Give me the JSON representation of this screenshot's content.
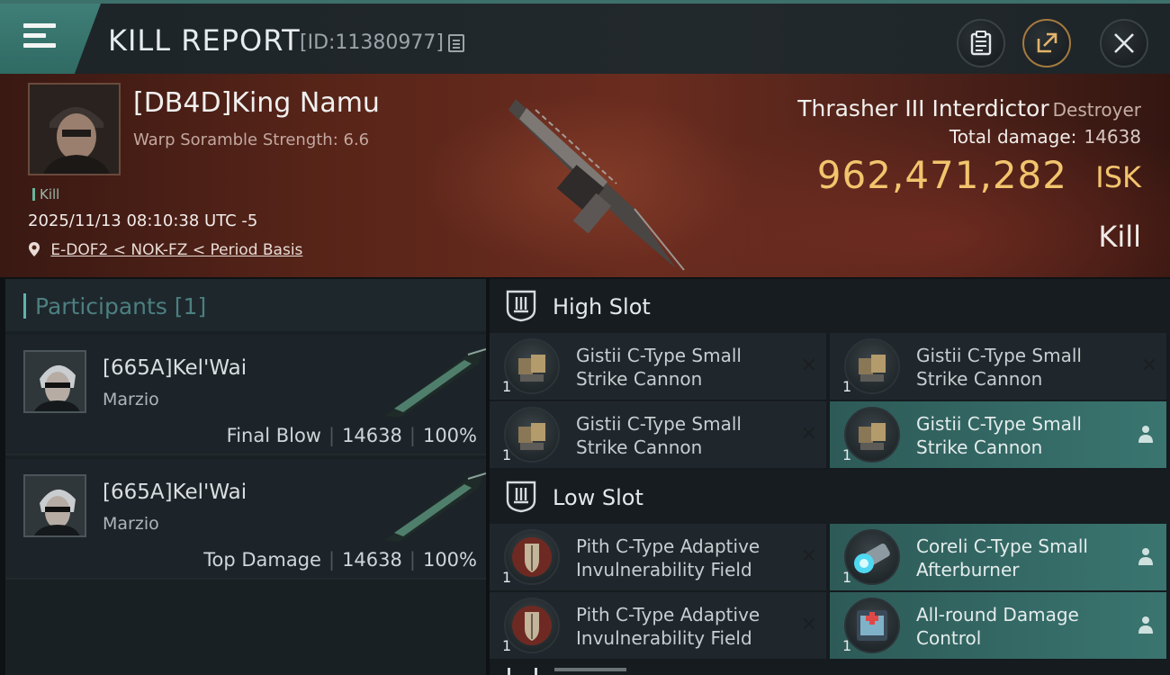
{
  "header": {
    "title": "KILL REPORT",
    "report_id": "[ID:11380977]"
  },
  "victim": {
    "name": "[DB4D]King Namu",
    "warp_scramble": "Warp Soramble Strength: 6.6",
    "tag": "Kill",
    "datetime": "2025/11/13 08:10:38 UTC -5",
    "location": "E-DOF2 < NOK-FZ < Period Basis",
    "ship_name": "Thrasher III Interdictor",
    "ship_class": "Destroyer",
    "total_damage_label": "Total damage:",
    "total_damage_value": "14638",
    "isk_value": "962,471,282",
    "isk_unit": "ISK",
    "result": "Kill"
  },
  "participants": {
    "header": "Participants [1]",
    "items": [
      {
        "name": "[665A]Kel'Wai",
        "corp": "Marzio",
        "role": "Final Blow",
        "damage": "14638",
        "percent": "100%"
      },
      {
        "name": "[665A]Kel'Wai",
        "corp": "Marzio",
        "role": "Top Damage",
        "damage": "14638",
        "percent": "100%"
      }
    ]
  },
  "fitting": {
    "high_slot": {
      "title": "High Slot",
      "modules": [
        {
          "line1": "Gistii C-Type Small",
          "line2": "Strike Cannon",
          "qty": "1",
          "status": "destroyed"
        },
        {
          "line1": "Gistii C-Type Small",
          "line2": "Strike Cannon",
          "qty": "1",
          "status": "destroyed"
        },
        {
          "line1": "Gistii C-Type Small",
          "line2": "Strike Cannon",
          "qty": "1",
          "status": "destroyed"
        },
        {
          "line1": "Gistii C-Type Small",
          "line2": "Strike Cannon",
          "qty": "1",
          "status": "dropped"
        }
      ]
    },
    "low_slot": {
      "title": "Low Slot",
      "modules": [
        {
          "line1": "Pith C-Type Adaptive",
          "line2": "Invulnerability Field",
          "qty": "1",
          "status": "destroyed"
        },
        {
          "line1": "Coreli C-Type Small",
          "line2": "Afterburner",
          "qty": "1",
          "status": "dropped"
        },
        {
          "line1": "Pith C-Type Adaptive",
          "line2": "Invulnerability Field",
          "qty": "1",
          "status": "destroyed"
        },
        {
          "line1": "All-round Damage",
          "line2": "Control",
          "qty": "1",
          "status": "dropped"
        }
      ]
    },
    "mark_destroyed": "✕"
  },
  "colors": {
    "accent_teal": "#3a7570",
    "isk_gold": "#f2c46d",
    "banner_red": "#5a2519"
  }
}
